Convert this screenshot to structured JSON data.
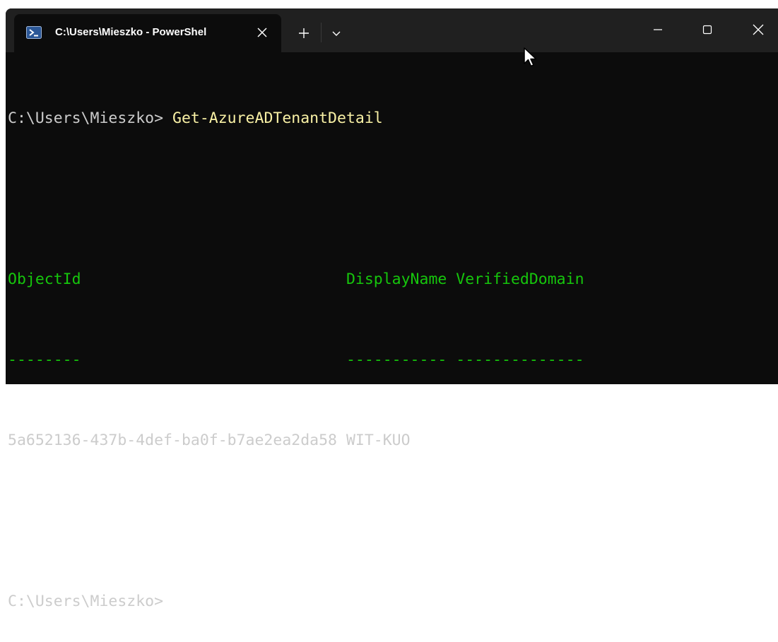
{
  "tab": {
    "title": "C:\\Users\\Mieszko - PowerShel",
    "icon": "powershell-icon"
  },
  "terminal": {
    "prompt1": "C:\\Users\\Mieszko>",
    "command": " Get-AzureADTenantDetail",
    "header": {
      "col1": "ObjectId",
      "col2": "DisplayName",
      "col3": "VerifiedDomain"
    },
    "underline": {
      "col1": "--------",
      "col2": "-----------",
      "col3": "--------------"
    },
    "row": {
      "object_id": "5a652136-437b-4def-ba0f-b7ae2ea2da58",
      "display_name": "WIT-KUO",
      "verified_domain": ""
    },
    "prompt2": "C:\\Users\\Mieszko>"
  },
  "colors": {
    "background": "#0c0c0c",
    "titlebar": "#202020",
    "text": "#cccccc",
    "command": "#f9f1a5",
    "header": "#16c60c"
  }
}
